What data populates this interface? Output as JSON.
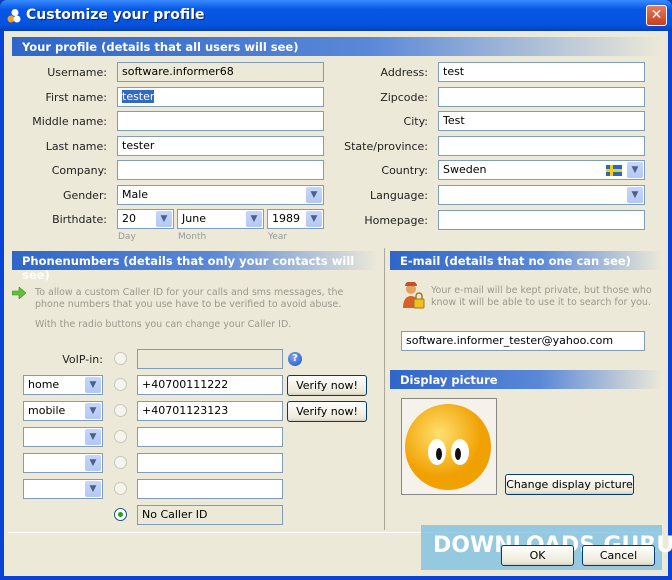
{
  "window": {
    "title": "Customize your profile",
    "close_icon": "close-icon"
  },
  "profile": {
    "header": "Your profile (details that all users will see)",
    "username_label": "Username:",
    "username": "software.informer68",
    "first_name_label": "First name:",
    "first_name": "tester",
    "middle_name_label": "Middle name:",
    "middle_name": "",
    "last_name_label": "Last name:",
    "last_name": "tester",
    "company_label": "Company:",
    "company": "",
    "gender_label": "Gender:",
    "gender": "Male",
    "birthdate_label": "Birthdate:",
    "day": "20",
    "month": "June",
    "year": "1989",
    "day_label": "Day",
    "month_label": "Month",
    "year_label": "Year",
    "address_label": "Address:",
    "address": "test",
    "zipcode_label": "Zipcode:",
    "zipcode": "",
    "city_label": "City:",
    "city": "Test",
    "state_label": "State/province:",
    "state": "",
    "country_label": "Country:",
    "country": "Sweden",
    "language_label": "Language:",
    "language": "",
    "homepage_label": "Homepage:",
    "homepage": ""
  },
  "phones": {
    "header": "Phonenumbers (details that only your contacts will see)",
    "note1": "To allow a custom Caller ID for your calls and sms messages, the phone numbers that you use have to be verified to avoid abuse.",
    "note2": "With the radio buttons you can change your Caller ID.",
    "voip_label": "VoIP-in:",
    "voip": "",
    "rows": [
      {
        "type": "home",
        "number": "+40700111222",
        "verify": "Verify now!"
      },
      {
        "type": "mobile",
        "number": "+40701123123",
        "verify": "Verify now!"
      },
      {
        "type": "",
        "number": ""
      },
      {
        "type": "",
        "number": ""
      },
      {
        "type": "",
        "number": ""
      }
    ],
    "no_caller_id": "No Caller ID"
  },
  "email": {
    "header": "E-mail (details that no one can see)",
    "note": "Your e-mail will be kept private, but those who know it will be able to use it to search for you.",
    "value": "software.informer_tester@yahoo.com"
  },
  "picture": {
    "header": "Display picture",
    "change_button": "Change display picture"
  },
  "footer": {
    "ok": "OK",
    "cancel": "Cancel"
  },
  "watermark": "DOWNLOADS.GURU",
  "colors": {
    "title_bar": "#0553de",
    "section_header": "#2f66c8",
    "background": "#ece9d8"
  }
}
